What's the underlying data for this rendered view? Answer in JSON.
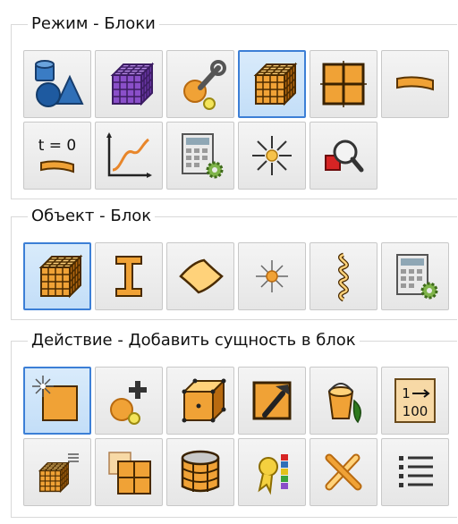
{
  "groups": [
    {
      "title": "Режим - Блоки",
      "tools": [
        {
          "name": "geometry-mode-button",
          "icon": "geometry-shapes-icon",
          "active": false
        },
        {
          "name": "mesh-mode-button",
          "icon": "purple-mesh-cube-icon",
          "active": false
        },
        {
          "name": "physics-mode-button",
          "icon": "wrench-node-icon",
          "active": false
        },
        {
          "name": "blocks-mode-button",
          "icon": "orange-block-cube-icon",
          "active": true
        },
        {
          "name": "blocks-grid-mode-button",
          "icon": "block-grid-icon",
          "active": false
        },
        {
          "name": "curve-mode-button",
          "icon": "curved-strip-icon",
          "active": false
        },
        {
          "name": "initial-conditions-button",
          "icon": "t-zero-icon",
          "active": false,
          "label": "t = 0"
        },
        {
          "name": "plot-mode-button",
          "icon": "graph-curve-icon",
          "active": false
        },
        {
          "name": "calculator-mode-button",
          "icon": "calculator-gear-icon",
          "active": false
        },
        {
          "name": "lights-mode-button",
          "icon": "sun-rays-icon",
          "active": false
        },
        {
          "name": "inspect-mode-button",
          "icon": "magnifier-shapes-icon",
          "active": false
        }
      ]
    },
    {
      "title": "Объект - Блок",
      "tools": [
        {
          "name": "block-object-button",
          "icon": "orange-block-cube-icon",
          "active": true
        },
        {
          "name": "beam-object-button",
          "icon": "i-beam-icon",
          "active": false
        },
        {
          "name": "shell-object-button",
          "icon": "shell-diamond-icon",
          "active": false
        },
        {
          "name": "point-object-button",
          "icon": "node-point-icon",
          "active": false
        },
        {
          "name": "spring-object-button",
          "icon": "spring-coil-icon",
          "active": false
        },
        {
          "name": "table-object-button",
          "icon": "calculator-gear-icon",
          "active": false
        }
      ]
    },
    {
      "title": "Действие - Добавить сущность в блок",
      "tools": [
        {
          "name": "new-block-button",
          "icon": "new-square-sparkle-icon",
          "active": true
        },
        {
          "name": "add-node-button",
          "icon": "add-node-icon",
          "active": false
        },
        {
          "name": "block-nodes-button",
          "icon": "cube-nodes-icon",
          "active": false
        },
        {
          "name": "hammer-button",
          "icon": "hammer-square-icon",
          "active": false
        },
        {
          "name": "fill-bucket-button",
          "icon": "paint-bucket-icon",
          "active": false
        },
        {
          "name": "numbering-button",
          "icon": "numbering-icon",
          "active": false,
          "label_top": "1",
          "label_bottom": "100"
        },
        {
          "name": "block-list-button",
          "icon": "small-cube-list-icon",
          "active": false
        },
        {
          "name": "split-block-button",
          "icon": "split-grid-icon",
          "active": false
        },
        {
          "name": "cylinder-block-button",
          "icon": "cylinder-block-icon",
          "active": false
        },
        {
          "name": "material-badge-button",
          "icon": "ribbon-badge-icon",
          "active": false
        },
        {
          "name": "delete-cross-button",
          "icon": "cross-tools-icon",
          "active": false
        },
        {
          "name": "list-view-button",
          "icon": "bullet-list-icon",
          "active": false
        }
      ]
    }
  ]
}
